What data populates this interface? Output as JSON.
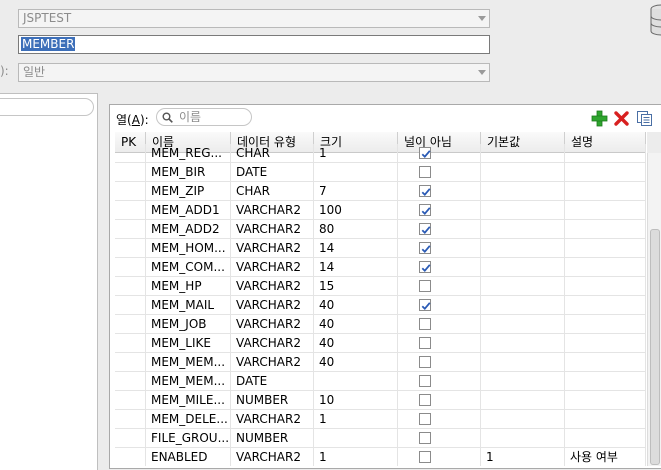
{
  "form": {
    "connection_value": "JSPTEST",
    "table_name_value": "MEMBER",
    "type_prefix": "):",
    "type_value": "일반"
  },
  "columns_panel": {
    "label_prefix": "열(",
    "label_mnemonic": "A",
    "label_suffix": "):",
    "filter_placeholder": "이름"
  },
  "table": {
    "headers": [
      "PK",
      "이름",
      "데이터 유형",
      "크기",
      "널이 아님",
      "기본값",
      "설명"
    ],
    "rows": [
      {
        "pk": "",
        "name": "MEM_REG...",
        "type": "CHAR",
        "size": "1",
        "not_null": true,
        "default": "",
        "comment": ""
      },
      {
        "pk": "",
        "name": "MEM_BIR",
        "type": "DATE",
        "size": "",
        "not_null": false,
        "default": "",
        "comment": ""
      },
      {
        "pk": "",
        "name": "MEM_ZIP",
        "type": "CHAR",
        "size": "7",
        "not_null": true,
        "default": "",
        "comment": ""
      },
      {
        "pk": "",
        "name": "MEM_ADD1",
        "type": "VARCHAR2",
        "size": "100",
        "not_null": true,
        "default": "",
        "comment": ""
      },
      {
        "pk": "",
        "name": "MEM_ADD2",
        "type": "VARCHAR2",
        "size": "80",
        "not_null": true,
        "default": "",
        "comment": ""
      },
      {
        "pk": "",
        "name": "MEM_HOM...",
        "type": "VARCHAR2",
        "size": "14",
        "not_null": true,
        "default": "",
        "comment": ""
      },
      {
        "pk": "",
        "name": "MEM_COM...",
        "type": "VARCHAR2",
        "size": "14",
        "not_null": true,
        "default": "",
        "comment": ""
      },
      {
        "pk": "",
        "name": "MEM_HP",
        "type": "VARCHAR2",
        "size": "15",
        "not_null": false,
        "default": "",
        "comment": ""
      },
      {
        "pk": "",
        "name": "MEM_MAIL",
        "type": "VARCHAR2",
        "size": "40",
        "not_null": true,
        "default": "",
        "comment": ""
      },
      {
        "pk": "",
        "name": "MEM_JOB",
        "type": "VARCHAR2",
        "size": "40",
        "not_null": false,
        "default": "",
        "comment": ""
      },
      {
        "pk": "",
        "name": "MEM_LIKE",
        "type": "VARCHAR2",
        "size": "40",
        "not_null": false,
        "default": "",
        "comment": ""
      },
      {
        "pk": "",
        "name": "MEM_MEM...",
        "type": "VARCHAR2",
        "size": "40",
        "not_null": false,
        "default": "",
        "comment": ""
      },
      {
        "pk": "",
        "name": "MEM_MEM...",
        "type": "DATE",
        "size": "",
        "not_null": false,
        "default": "",
        "comment": ""
      },
      {
        "pk": "",
        "name": "MEM_MILE...",
        "type": "NUMBER",
        "size": "10",
        "not_null": false,
        "default": "",
        "comment": ""
      },
      {
        "pk": "",
        "name": "MEM_DELE...",
        "type": "VARCHAR2",
        "size": "1",
        "not_null": false,
        "default": "",
        "comment": ""
      },
      {
        "pk": "",
        "name": "FILE_GROU...",
        "type": "NUMBER",
        "size": "",
        "not_null": false,
        "default": "",
        "comment": ""
      },
      {
        "pk": "",
        "name": "ENABLED",
        "type": "VARCHAR2",
        "size": "1",
        "not_null": false,
        "default": "1",
        "comment": "사용 여부"
      }
    ]
  },
  "icons": {
    "add": "plus-icon",
    "remove": "x-icon",
    "copy": "copy-icon",
    "database": "database-icon",
    "search": "search-icon"
  },
  "colors": {
    "selection": "#3d6fb9",
    "add_green": "#2fa52f",
    "remove_red": "#d82020",
    "check_blue": "#2a5ab5"
  }
}
